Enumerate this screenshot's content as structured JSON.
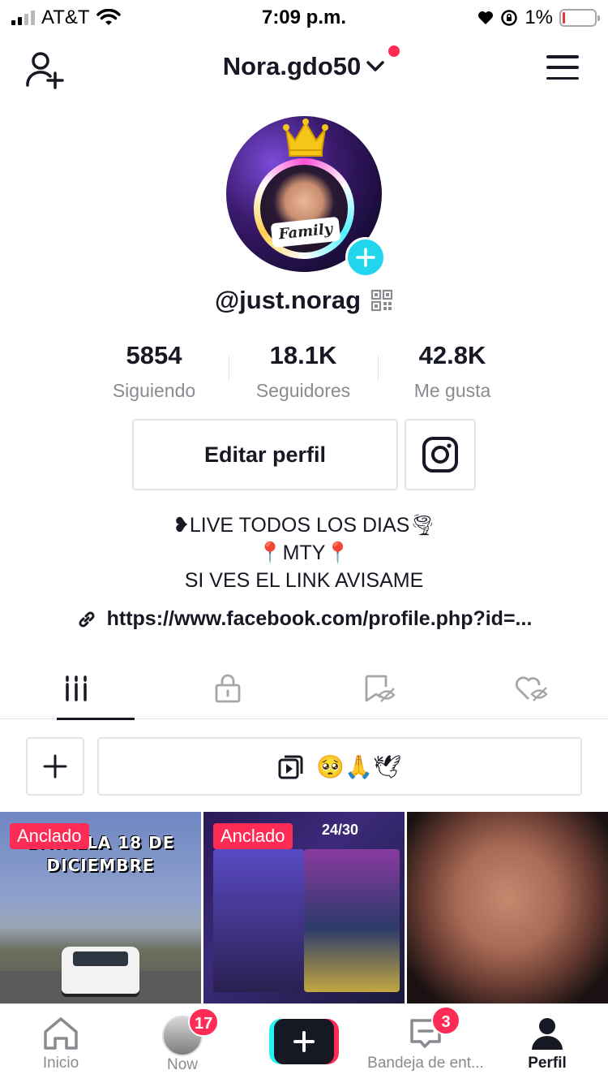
{
  "status_bar": {
    "carrier": "AT&T",
    "time": "7:09 p.m.",
    "battery_percent": "1%"
  },
  "header": {
    "username": "Nora.gdo50"
  },
  "profile": {
    "handle": "@just.norag",
    "avatar_text": "Family",
    "stats": [
      {
        "value": "5854",
        "label": "Siguiendo"
      },
      {
        "value": "18.1K",
        "label": "Seguidores"
      },
      {
        "value": "42.8K",
        "label": "Me gusta"
      }
    ],
    "edit_button": "Editar perfil",
    "bio": [
      "❥LIVE TODOS LOS DIAS🌪",
      "📍MTY📍",
      "SI VES EL LINK AVISAME"
    ],
    "link": "https://www.facebook.com/profile.php?id=..."
  },
  "playlist": {
    "emojis": "🥺🙏🕊"
  },
  "videos": [
    {
      "badge": "Anclado",
      "overlay_title": "BATALLA 18 DE DICIEMBRE"
    },
    {
      "badge": "Anclado",
      "overlay_score": "24/30"
    },
    {
      "badge": ""
    }
  ],
  "bottom_nav": {
    "items": [
      {
        "label": "Inicio",
        "icon": "home-icon"
      },
      {
        "label": "Now",
        "icon": "now-avatar",
        "badge": "17"
      },
      {
        "label": "",
        "icon": "create-icon"
      },
      {
        "label": "Bandeja de ent...",
        "icon": "inbox-icon",
        "badge": "3"
      },
      {
        "label": "Perfil",
        "icon": "profile-icon"
      }
    ]
  },
  "colors": {
    "accent": "#fe2c55",
    "cyan": "#25f4ee",
    "text": "#161823",
    "muted": "#8a8b91"
  }
}
